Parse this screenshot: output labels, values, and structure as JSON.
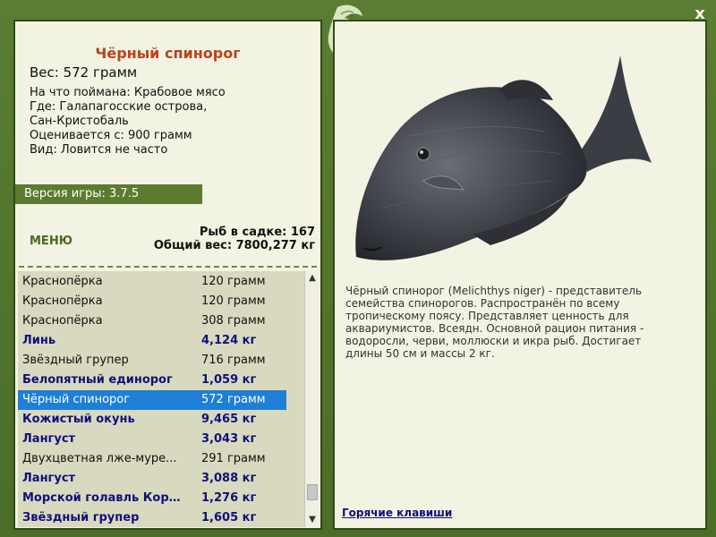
{
  "window": {
    "close_label": "x"
  },
  "fish": {
    "title": "Чёрный спинорог",
    "weight": "Вес: 572 грамм",
    "bait": "На что поймана: Крабовое мясо",
    "location_line1": "Где: Галапагосские острова,",
    "location_line2": "Сан-Кристобаль",
    "valued": "Оценивается с: 900 грамм",
    "type": "Вид: Ловится не часто"
  },
  "version": "Версия игры: 3.7.5",
  "menu_label": "МЕНЮ",
  "stats": {
    "fish_in_cage": "Рыб в садке: 167",
    "total_weight": "Общий вес: 7800,277 кг"
  },
  "catch_list": [
    {
      "name": "Краснопёрка",
      "weight": "120 грамм",
      "style": "normal"
    },
    {
      "name": "Краснопёрка",
      "weight": "120 грамм",
      "style": "normal"
    },
    {
      "name": "Краснопёрка",
      "weight": "308 грамм",
      "style": "normal"
    },
    {
      "name": "Линь",
      "weight": "4,124 кг",
      "style": "big"
    },
    {
      "name": "Звёздный групер",
      "weight": "716 грамм",
      "style": "normal"
    },
    {
      "name": "Белопятный единорог",
      "weight": "1,059 кг",
      "style": "big"
    },
    {
      "name": "Чёрный спинорог",
      "weight": "572 грамм",
      "style": "sel"
    },
    {
      "name": "Кожистый окунь",
      "weight": "9,465 кг",
      "style": "big"
    },
    {
      "name": "Лангуст",
      "weight": "3,043 кг",
      "style": "big"
    },
    {
      "name": "Двухцветная лже-муре...",
      "weight": "291 грамм",
      "style": "normal"
    },
    {
      "name": "Лангуст",
      "weight": "3,088 кг",
      "style": "big"
    },
    {
      "name": "Морской голавль Корт...",
      "weight": "1,276 кг",
      "style": "big"
    },
    {
      "name": "Звёздный групер",
      "weight": "1,605 кг",
      "style": "big"
    }
  ],
  "description": "Чёрный спинорог (Melichthys niger) - представитель семейства спинорогов. Распространён по всему тропическому поясу. Представляет ценность для аквариумистов. Всеядн. Основной рацион питания - водоросли, черви, моллюски и икра рыб. Достигает длины 50 см и массы 2 кг.",
  "hotkeys_label": "Горячие клавиши",
  "colors": {
    "frame": "#4b6e27",
    "panel": "#f3f3e3",
    "title": "#b8431b",
    "big_fish": "#10107c",
    "selection": "#1e7fd6"
  }
}
